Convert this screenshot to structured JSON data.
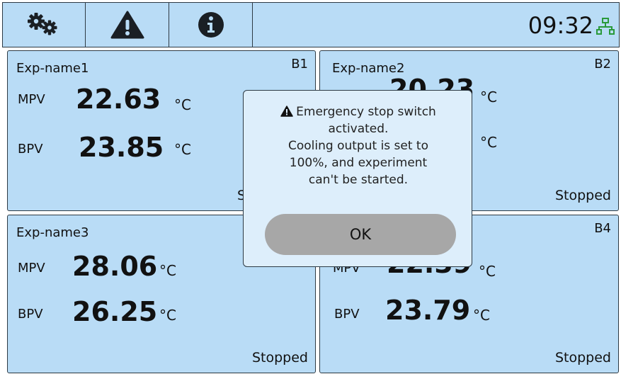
{
  "topbar": {
    "buttons": [
      {
        "icon": "gears-icon"
      },
      {
        "icon": "warning-icon"
      },
      {
        "icon": "info-icon"
      }
    ],
    "time": "09:32",
    "network_icon": "network-icon"
  },
  "panels": [
    {
      "name": "Exp-name1",
      "id": "B1",
      "mpv_label": "MPV",
      "mpv": "22.63",
      "bpv_label": "BPV",
      "bpv": "23.85",
      "unit": "°C",
      "status": "S"
    },
    {
      "name": "Exp-name2",
      "id": "B2",
      "mpv_label": "",
      "mpv": "20.23",
      "bpv_label": "",
      "bpv": "",
      "unit": "°C",
      "status": "Stopped"
    },
    {
      "name": "Exp-name3",
      "id": "",
      "mpv_label": "MPV",
      "mpv": "28.06",
      "bpv_label": "BPV",
      "bpv": "26.25",
      "unit": "°C",
      "status": "Stopped"
    },
    {
      "name": "",
      "id": "B4",
      "mpv_label": "MPV",
      "mpv": "22.39",
      "bpv_label": "BPV",
      "bpv": "23.79",
      "unit": "°C",
      "status": "Stopped"
    }
  ],
  "dialog": {
    "line1": "Emergency stop switch",
    "line2": "activated.",
    "line3": "Cooling output is set to",
    "line4": "100%, and experiment",
    "line5": "can't be started.",
    "ok_label": "OK"
  },
  "colors": {
    "panel_bg": "#b9dcf6",
    "dialog_bg": "#ddeefb",
    "button_gray": "#a7a7a7",
    "network_green": "#2a9a3a",
    "border": "#2d3a44"
  }
}
